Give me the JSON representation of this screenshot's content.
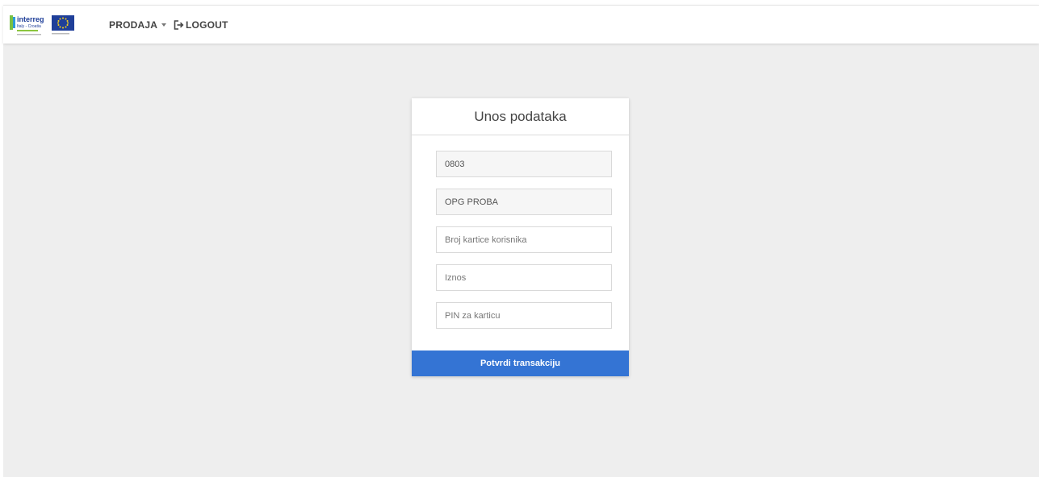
{
  "logo": {
    "brand": "interreg",
    "subtitle": "Italy - Croatia",
    "icon": "interreg-eu-logo"
  },
  "nav": {
    "prodaja_label": "PRODAJA",
    "logout_label": "LOGOUT"
  },
  "form": {
    "title": "Unos podataka",
    "fields": [
      {
        "value": "0803",
        "placeholder": ""
      },
      {
        "value": "OPG PROBA",
        "placeholder": ""
      },
      {
        "value": "",
        "placeholder": "Broj kartice korisnika"
      },
      {
        "value": "",
        "placeholder": "Iznos"
      },
      {
        "value": "",
        "placeholder": "PIN za karticu"
      }
    ],
    "submit_label": "Potvrdi transakciju"
  },
  "colors": {
    "primary": "#3474d4",
    "background": "#eeeeee",
    "eu_blue": "#1f3f99",
    "eu_star": "#ffd617"
  }
}
